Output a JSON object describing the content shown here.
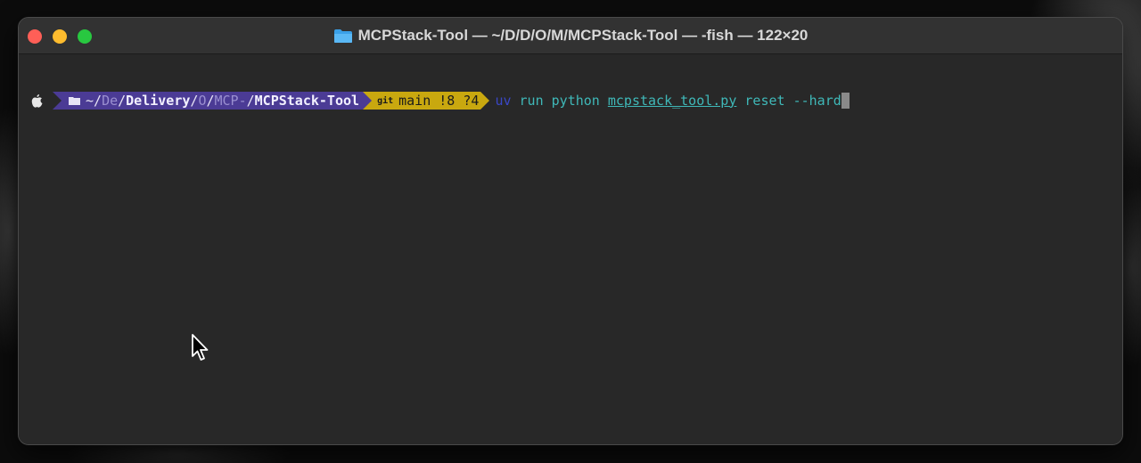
{
  "window": {
    "title": "MCPStack-Tool — ~/D/D/O/M/MCPStack-Tool — -fish — 122×20",
    "title_icon": "folder-icon"
  },
  "prompt": {
    "os_icon": "apple-icon",
    "dir_icon": "folder-icon",
    "path_parts": [
      "~/",
      "De",
      "/",
      "Delivery",
      "/",
      "O",
      "/",
      "MCP-",
      "/",
      "MCPStack-Tool"
    ],
    "git_icon_text": "git",
    "git_branch": "main",
    "git_status": "!8 ?4",
    "dir_segment_color": "#4b3b95",
    "git_segment_color": "#c9a80f"
  },
  "command": {
    "uv": "uv",
    "run": "run",
    "python": "python",
    "file": "mcpstack_tool.py",
    "reset": "reset",
    "flag": "--hard",
    "color": "#3fb8b8",
    "uv_color": "#3a47c6"
  },
  "colors": {
    "close": "#ff5f57",
    "minimize": "#febc2e",
    "zoom": "#28c840",
    "terminal_bg": "#282828"
  }
}
